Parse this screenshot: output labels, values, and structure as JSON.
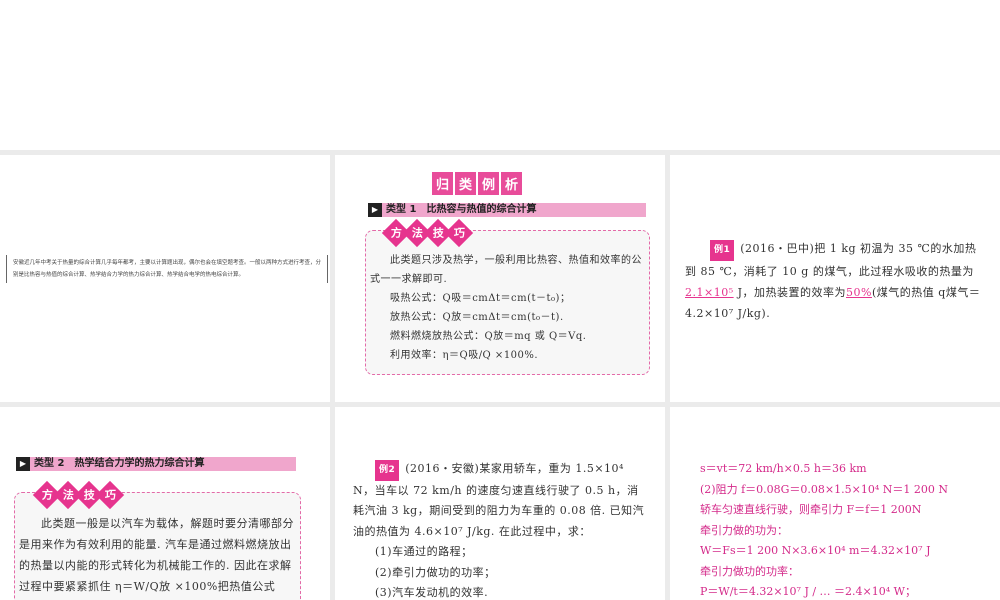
{
  "intro": "安徽近几年中考关于热量的综合计算几乎每年都考，主要以计算题出现，偶尔也会在填空题考查。一般以两种方式进行考查，分别是比热容与热值的综合计算、热学结合力学的热力综合计算、热学结合电学的热电综合计算。",
  "banner": [
    "归",
    "类",
    "例",
    "析"
  ],
  "type1": {
    "label": "类型 1　比热容与热值的综合计算",
    "badges": [
      "方",
      "法",
      "技",
      "巧"
    ],
    "lines": [
      "此类题只涉及热学，一般利用比热容、热值和效率的公式一一求解即可.",
      "吸热公式：Q吸＝cmΔt＝cm(t－t₀)；",
      "放热公式：Q放＝cmΔt＝cm(t₀－t).",
      "燃料燃烧放热公式：Q放＝mq 或 Q＝Vq.",
      "利用效率：η＝Q吸/Q ×100%."
    ]
  },
  "example1": {
    "tag": "例1",
    "text_a": "(2016・巴中)把 1 kg 初温为 35 ℃的水加热到 85 ℃，消耗了 10 g 的煤气，此过程水吸收的热量为",
    "answer1": "2.1×10⁵",
    "text_b": " J，加热装置的效率为",
    "answer2": "50%",
    "text_c": "(煤气的热值 q煤气＝4.2×10⁷ J/kg)."
  },
  "type2": {
    "label": "类型 2　热学结合力学的热力综合计算",
    "badges": [
      "方",
      "法",
      "技",
      "巧"
    ],
    "text": "此类题一般是以汽车为载体，解题时要分清哪部分是用来作为有效利用的能量. 汽车是通过燃料燃烧放出的热量以内能的形式转化为机械能工作的. 因此在求解过程中要紧紧抓住 η＝W/Q放 ×100%把热值公式"
  },
  "example2": {
    "tag": "例2",
    "text": "(2016・安徽)某家用轿车，重为 1.5×10⁴ N，当车以 72 km/h 的速度匀速直线行驶了 0.5 h，消耗汽油 3 kg，期间受到的阻力为车重的 0.08 倍. 已知汽油的热值为 4.6×10⁷ J/kg. 在此过程中，求：",
    "questions": [
      "(1)车通过的路程；",
      "(2)牵引力做功的功率；",
      "(3)汽车发动机的效率."
    ]
  },
  "solution": [
    "s＝vt＝72 km/h×0.5 h＝36 km",
    "(2)阻力 f＝0.08G＝0.08×1.5×10⁴ N＝1 200 N",
    "轿车匀速直线行驶，则牵引力 F＝f＝1 200N",
    "牵引力做的功为：",
    "W＝Fs＝1 200 N×3.6×10⁴ m＝4.32×10⁷ J",
    "牵引力做功的功率：",
    "P＝W/t＝4.32×10⁷ J / … ＝2.4×10⁴ W；"
  ]
}
